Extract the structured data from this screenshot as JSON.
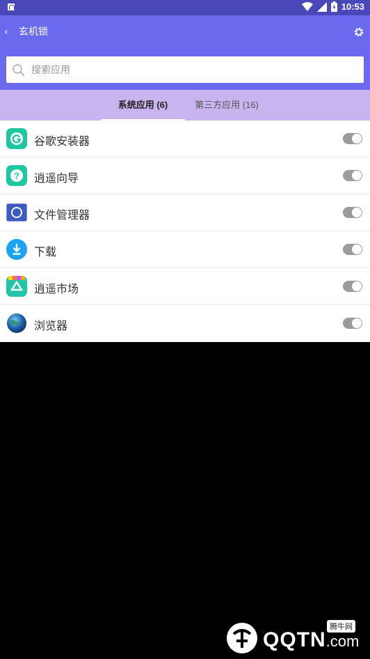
{
  "status_bar": {
    "time": "10:53"
  },
  "app_bar": {
    "title": "玄机锁"
  },
  "search": {
    "placeholder": "搜索应用",
    "value": ""
  },
  "tabs": [
    {
      "label": "系统应用 (6)",
      "selected": true
    },
    {
      "label": "第三方应用 (16)",
      "selected": false
    }
  ],
  "apps": [
    {
      "name": "谷歌安装器",
      "icon": "google-installer-icon",
      "enabled": true
    },
    {
      "name": "逍遥向导",
      "icon": "help-icon",
      "enabled": true
    },
    {
      "name": "文件管理器",
      "icon": "file-manager-icon",
      "enabled": true
    },
    {
      "name": "下载",
      "icon": "download-icon",
      "enabled": true
    },
    {
      "name": "逍遥市场",
      "icon": "market-icon",
      "enabled": true
    },
    {
      "name": "浏览器",
      "icon": "browser-globe-icon",
      "enabled": true
    }
  ],
  "watermark": {
    "text": "QQTN",
    "suffix": ".com",
    "badge": "腾牛网"
  },
  "colors": {
    "primary": "#6b6aee",
    "status": "#4a47b8",
    "tab_bar": "#c8b5f0",
    "toggle": "#9b9b9b"
  }
}
